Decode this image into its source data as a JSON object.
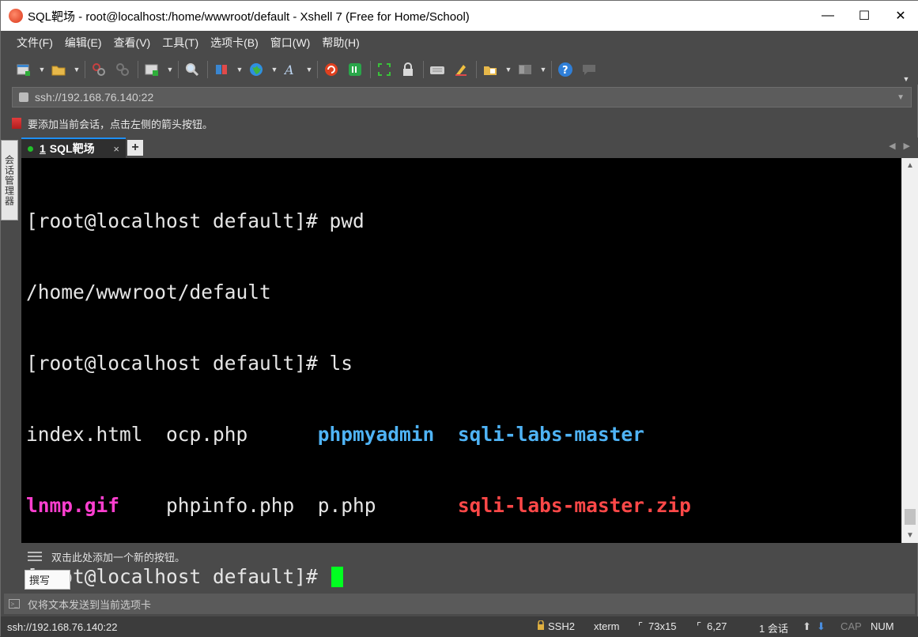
{
  "window": {
    "title": "SQL靶场 - root@localhost:/home/wwwroot/default - Xshell 7 (Free for Home/School)",
    "controls": {
      "minimize": "—",
      "maximize": "☐",
      "close": "✕"
    }
  },
  "menubar": {
    "items": [
      "文件(F)",
      "编辑(E)",
      "查看(V)",
      "工具(T)",
      "选项卡(B)",
      "窗口(W)",
      "帮助(H)"
    ]
  },
  "toolbar": {
    "icons": [
      "new-session-icon",
      "open-folder-icon",
      "disconnect-icon",
      "reconnect-icon",
      "new-tab-icon",
      "find-icon",
      "transfer-icon",
      "globe-icon",
      "font-icon",
      "xshell-icon",
      "xftp-icon",
      "fullscreen-icon",
      "lock-icon",
      "keyboard-icon",
      "highlight-icon",
      "compose-icon",
      "layout-icon",
      "help-icon",
      "chat-icon"
    ]
  },
  "address": {
    "value": "ssh://192.168.76.140:22"
  },
  "infobar": {
    "text": "要添加当前会话，点击左侧的箭头按钮。"
  },
  "sidetab": {
    "label": "会话管理器"
  },
  "tabs": [
    {
      "number": "1",
      "label": "SQL靶场",
      "close": "×"
    }
  ],
  "tab_add": "+",
  "tab_nav": {
    "prev": "◀",
    "next": "▶"
  },
  "terminal": {
    "line1": "[root@localhost default]# pwd",
    "line2": "/home/wwwroot/default",
    "line3": "[root@localhost default]# ls",
    "ls_row1": [
      "index.html  ",
      "ocp.php      ",
      "phpmyadmin",
      "  ",
      "sqli-labs-master"
    ],
    "ls_row2": [
      "lnmp.gif",
      "    ",
      "phpinfo.php  ",
      "p.php       ",
      "sqli-labs-master.zip"
    ],
    "line6": "[root@localhost default]# ",
    "colors": {
      "directory": "#4fb3f5",
      "image": "#ff3fd0",
      "archive": "#ff4848",
      "cursor": "#00ff20"
    }
  },
  "quickbar": {
    "text": "双击此处添加一个新的按钮。"
  },
  "compose": {
    "label": "撰写"
  },
  "sendbar": {
    "text": "仅将文本发送到当前选项卡"
  },
  "statusbar": {
    "address": "ssh://192.168.76.140:22",
    "protocol": "SSH2",
    "terminal_type": "xterm",
    "size": "73x15",
    "cursor_pos": "6,27",
    "sessions": "1 会话",
    "cap": "CAP",
    "num": "NUM"
  }
}
